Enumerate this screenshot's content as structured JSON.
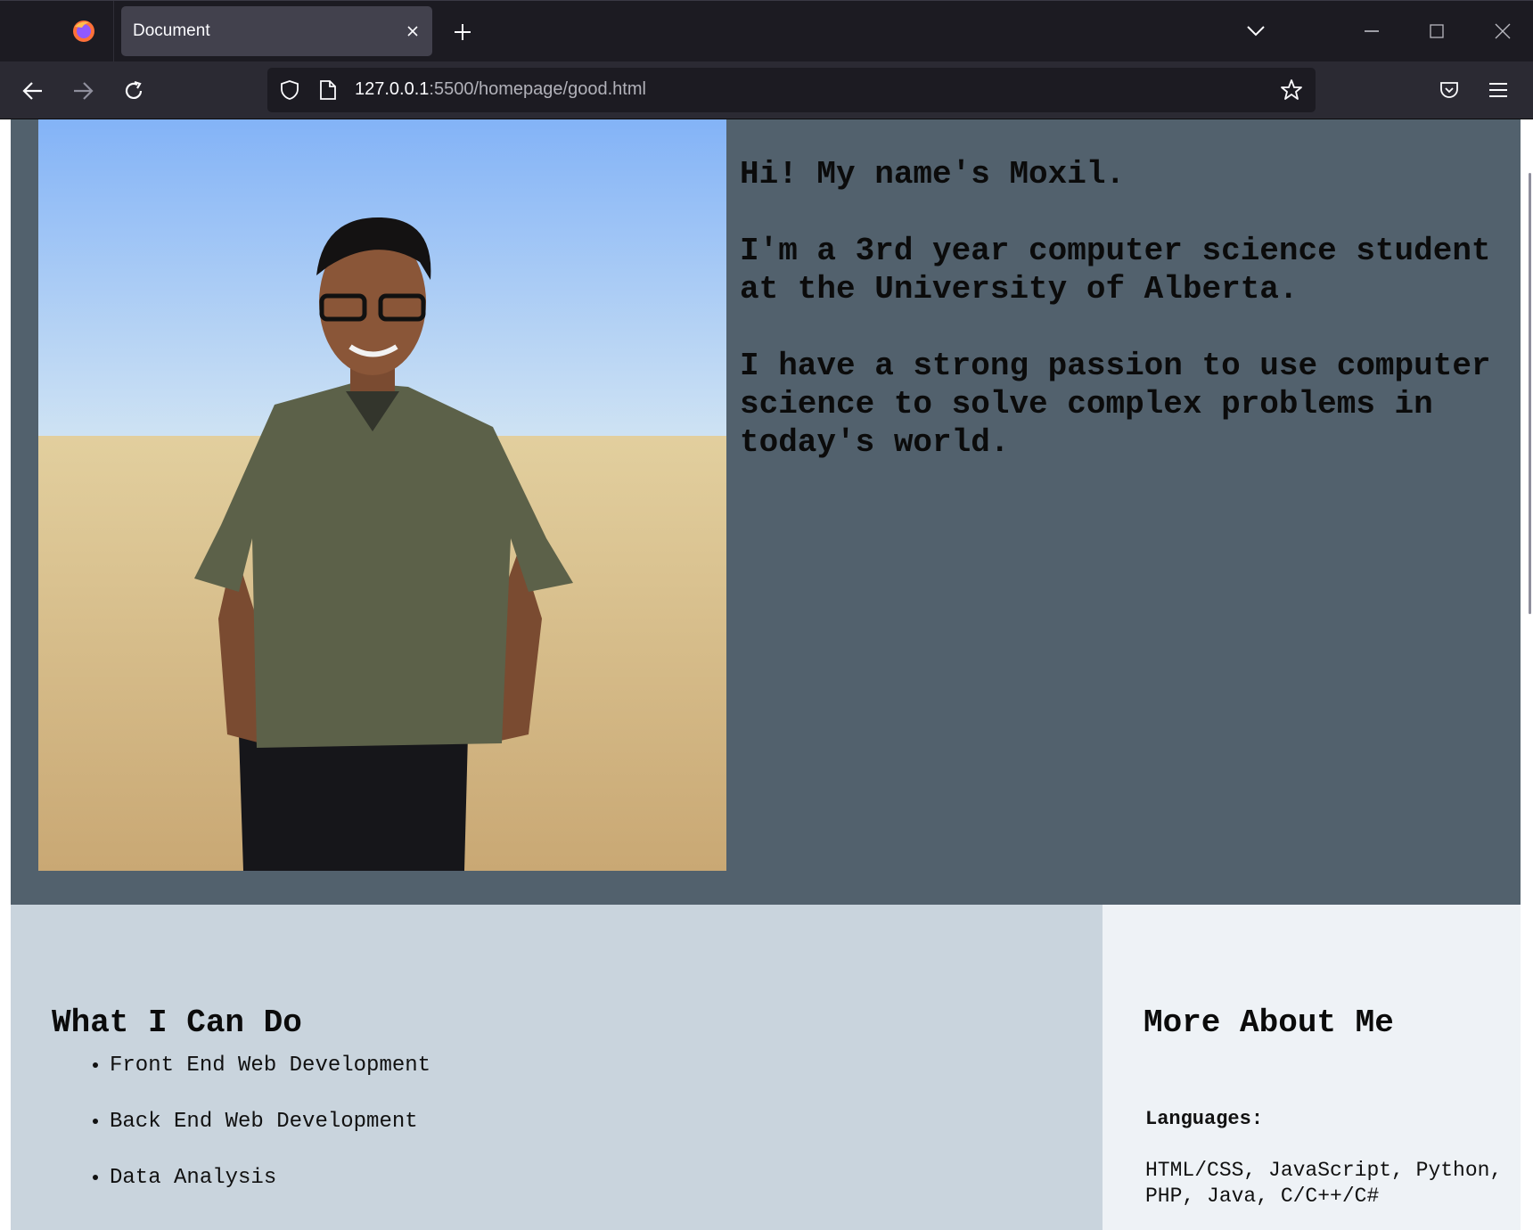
{
  "browser": {
    "tab_title": "Document",
    "url_host": "127.0.0.1",
    "url_rest": ":5500/homepage/good.html"
  },
  "hero": {
    "intro_lines": [
      "Hi! My name's Moxil.",
      "I'm a 3rd year computer science student at the University of Alberta.",
      "I have a strong passion to use computer science to solve complex problems in today's world."
    ]
  },
  "skills": {
    "heading": "What I Can Do",
    "items": [
      "Front End Web Development",
      "Back End Web Development",
      "Data Analysis"
    ]
  },
  "about": {
    "heading": "More About Me",
    "languages_label": "Languages:",
    "languages_value": "HTML/CSS, JavaScript, Python, PHP, Java, C/C++/C#"
  },
  "colors": {
    "hero_bg": "#52616d",
    "skills_bg": "#c9d4dd",
    "about_bg": "#eef2f6",
    "chrome_dark": "#1c1b22"
  }
}
